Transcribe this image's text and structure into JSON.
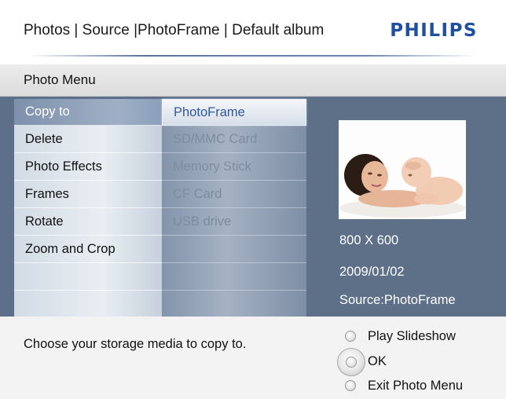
{
  "header": {
    "breadcrumb": "Photos | Source |PhotoFrame | Default album",
    "brand": "PHILIPS"
  },
  "menu": {
    "title": "Photo Menu",
    "items": [
      {
        "label": "Copy to",
        "selected": true
      },
      {
        "label": "Delete"
      },
      {
        "label": "Photo Effects"
      },
      {
        "label": "Frames"
      },
      {
        "label": "Rotate"
      },
      {
        "label": "Zoom and Crop"
      }
    ]
  },
  "submenu": {
    "items": [
      {
        "label": "PhotoFrame",
        "selected": true
      },
      {
        "label": "SD/MMC Card"
      },
      {
        "label": "Memory Stick"
      },
      {
        "label": "CF Card"
      },
      {
        "label": "USB drive"
      }
    ]
  },
  "photo": {
    "resolution": "800 X 600",
    "date": "2009/01/02",
    "source": "Source:PhotoFrame"
  },
  "footer": {
    "hint": "Choose your storage media to copy to.",
    "controls": [
      {
        "label": "Play Slideshow",
        "icon": "radio-button-icon"
      },
      {
        "label": "OK",
        "icon": "ok-button-icon"
      },
      {
        "label": "Exit Photo Menu",
        "icon": "radio-button-icon"
      }
    ]
  },
  "colors": {
    "brand": "#1f4f9f",
    "panel": "#5d6f89",
    "selected_text": "#2f5a9a"
  }
}
